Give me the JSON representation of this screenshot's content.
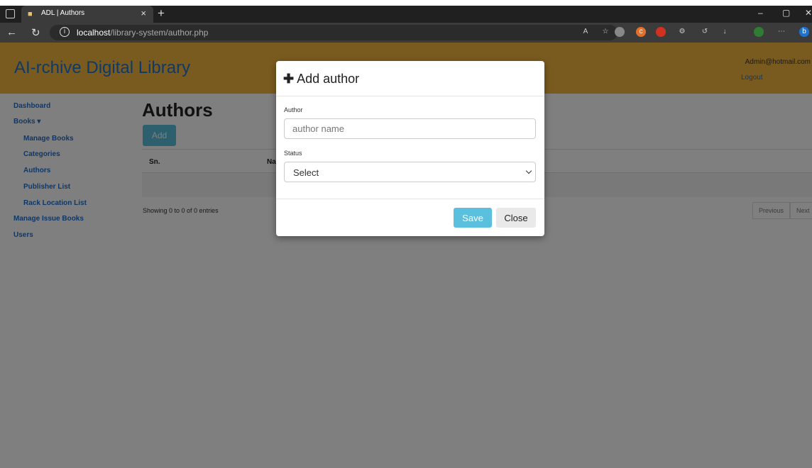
{
  "browser": {
    "tab_title": "ADL | Authors",
    "tab_close": "×",
    "new_tab": "+",
    "url_host": "localhost",
    "url_path": "/library-system/author.php",
    "win_min": "–",
    "win_max": "▢",
    "win_close": "✕"
  },
  "header": {
    "logo": "AI-rchive Digital Library",
    "user_email": "Admin@hotmail.com",
    "logout": "Logout"
  },
  "sidebar": {
    "items": [
      {
        "label": "Dashboard"
      },
      {
        "label": "Books ▾"
      },
      {
        "label": "Manage Books"
      },
      {
        "label": "Categories"
      },
      {
        "label": "Authors"
      },
      {
        "label": "Publisher List"
      },
      {
        "label": "Rack Location List"
      },
      {
        "label": "Manage Issue Books"
      },
      {
        "label": "Users"
      }
    ]
  },
  "content": {
    "title": "Authors",
    "add_label": "Add",
    "columns": [
      "Sn.",
      "Na"
    ],
    "showing": "Showing 0 to 0 of 0 entries",
    "prev_label": "Previous",
    "next_label": "Next"
  },
  "modal": {
    "title": "Add author",
    "author_label": "Author",
    "author_placeholder": "author name",
    "status_label": "Status",
    "status_selected": "Select",
    "save_label": "Save",
    "close_label": "Close"
  }
}
